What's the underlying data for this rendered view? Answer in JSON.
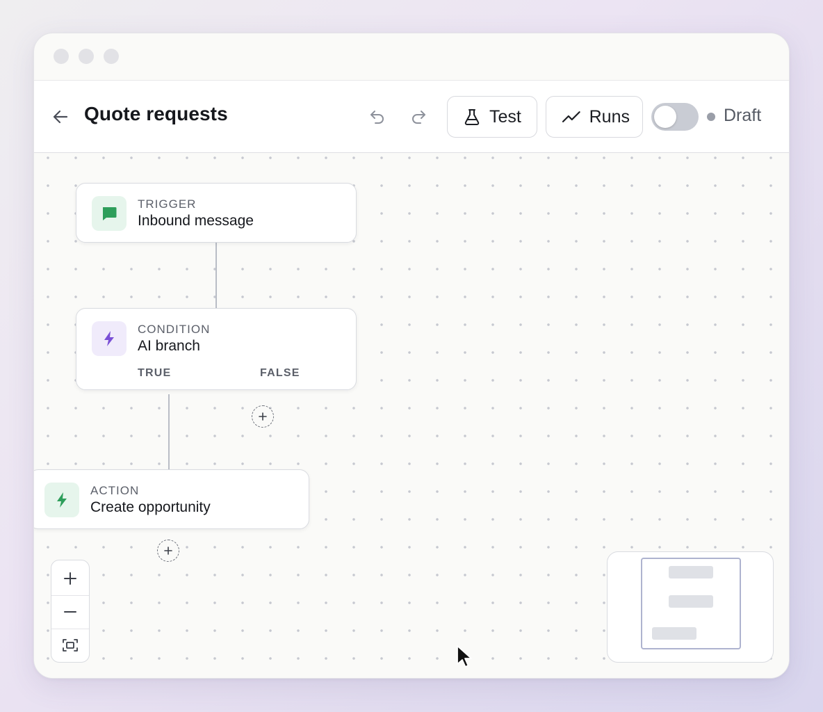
{
  "window": {
    "controls": [
      "close",
      "minimize",
      "maximize"
    ]
  },
  "toolbar": {
    "back_icon": "arrow-left-icon",
    "title": "Quote requests",
    "undo_icon": "undo-icon",
    "redo_icon": "redo-icon",
    "test_label": "Test",
    "test_icon": "flask-icon",
    "runs_label": "Runs",
    "runs_icon": "trend-line-icon",
    "publish_toggle": {
      "on": false
    },
    "status_label": "Draft",
    "status_color": "#9a9ea8"
  },
  "flow": {
    "nodes": [
      {
        "type": "TRIGGER",
        "name": "Inbound message",
        "icon": "chat-bubble-icon",
        "icon_color": "#2e9e5b",
        "icon_bg": "#e6f5ec"
      },
      {
        "type": "CONDITION",
        "name": "AI branch",
        "icon": "lightning-icon",
        "icon_color": "#7a4fd6",
        "icon_bg": "#f0ebfb",
        "branches": [
          "TRUE",
          "FALSE"
        ]
      },
      {
        "type": "ACTION",
        "name": "Create opportunity",
        "icon": "lightning-icon",
        "icon_color": "#2e9e5b",
        "icon_bg": "#e6f5ec"
      }
    ]
  },
  "controls": {
    "zoom_in_icon": "plus-icon",
    "zoom_out_icon": "minus-icon",
    "fit_view_icon": "fit-view-icon"
  },
  "colors": {
    "accent_purple": "#7a4fd6",
    "accent_green": "#2e9e5b"
  }
}
